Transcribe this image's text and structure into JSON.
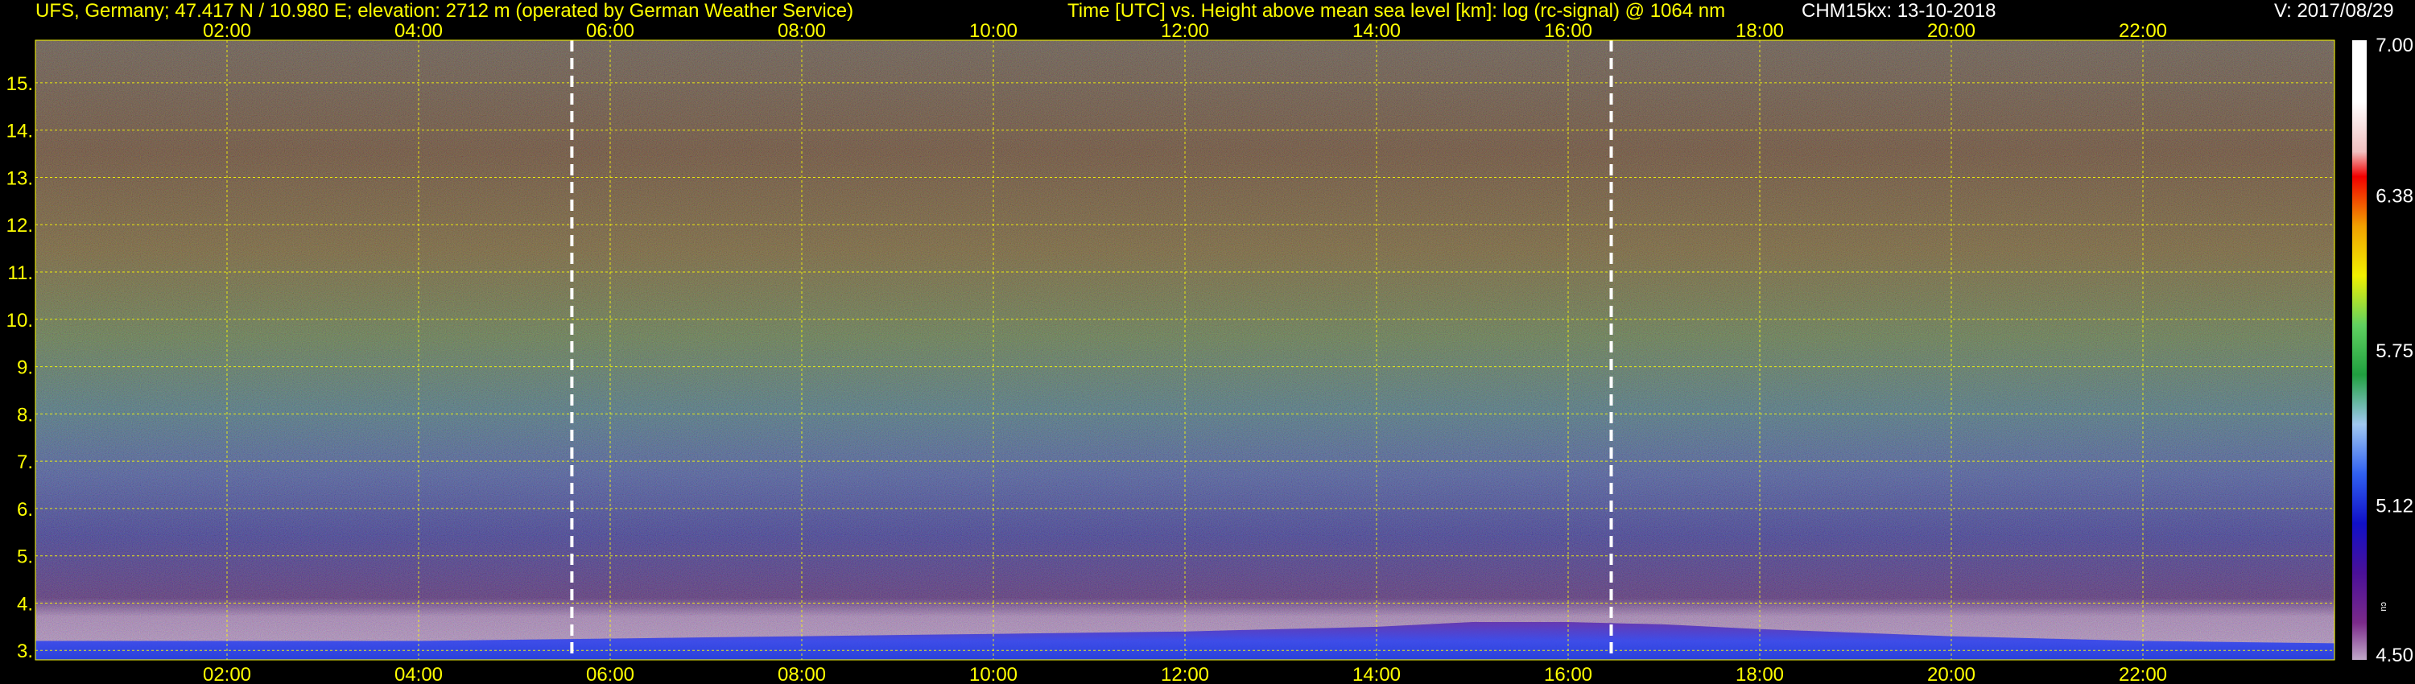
{
  "header": {
    "station": "UFS, Germany; 47.417 N / 10.980 E; elevation: 2712 m  (operated by German Weather Service)",
    "axes_desc": "Time [UTC] vs. Height above mean sea level [km]: log (rc-signal) @ 1064 nm",
    "instrument": "CHM15kx: 13-10-2018",
    "version": "V: 2017/08/29"
  },
  "colors": {
    "text": "#ffff00",
    "grid": "#ffff00",
    "background": "#000000",
    "marker": "#ffffff"
  },
  "chart_data": {
    "type": "heatmap",
    "title": "Time [UTC] vs. Height above mean sea level [km]: log (rc-signal) @ 1064 nm",
    "xlabel": "Time [UTC]",
    "ylabel": "Height above mean sea level [km]",
    "x_ticks": [
      "02:00",
      "04:00",
      "06:00",
      "08:00",
      "10:00",
      "12:00",
      "14:00",
      "16:00",
      "18:00",
      "20:00",
      "22:00"
    ],
    "x_tick_hours": [
      2,
      4,
      6,
      8,
      10,
      12,
      14,
      16,
      18,
      20,
      22
    ],
    "xlim_hours": [
      0,
      24
    ],
    "y_ticks": [
      "3.",
      "4.",
      "5.",
      "6.",
      "7.",
      "8.",
      "9.",
      "10.",
      "11.",
      "12.",
      "13.",
      "14.",
      "15."
    ],
    "y_tick_values": [
      3,
      4,
      5,
      6,
      7,
      8,
      9,
      10,
      11,
      12,
      13,
      14,
      15
    ],
    "ylim_km": [
      2.8,
      15.9
    ],
    "grid": true,
    "marker_lines_hours": [
      5.6,
      16.45
    ],
    "colorbar": {
      "range": [
        4.5,
        7.0
      ],
      "tick_labels": [
        "7.00",
        "6.38",
        "5.75",
        "5.12",
        "4.50"
      ],
      "tick_values": [
        7.0,
        6.375,
        5.75,
        5.125,
        4.5
      ],
      "small_label": "cu"
    },
    "layers": [
      {
        "name": "boundary layer top",
        "hours": [
          0,
          2,
          4,
          6,
          8,
          10,
          12,
          14,
          15,
          16,
          17,
          18,
          20,
          22,
          24
        ],
        "top_km": [
          3.2,
          3.2,
          3.2,
          3.25,
          3.3,
          3.35,
          3.4,
          3.5,
          3.6,
          3.6,
          3.55,
          3.45,
          3.3,
          3.2,
          3.15
        ]
      }
    ]
  }
}
